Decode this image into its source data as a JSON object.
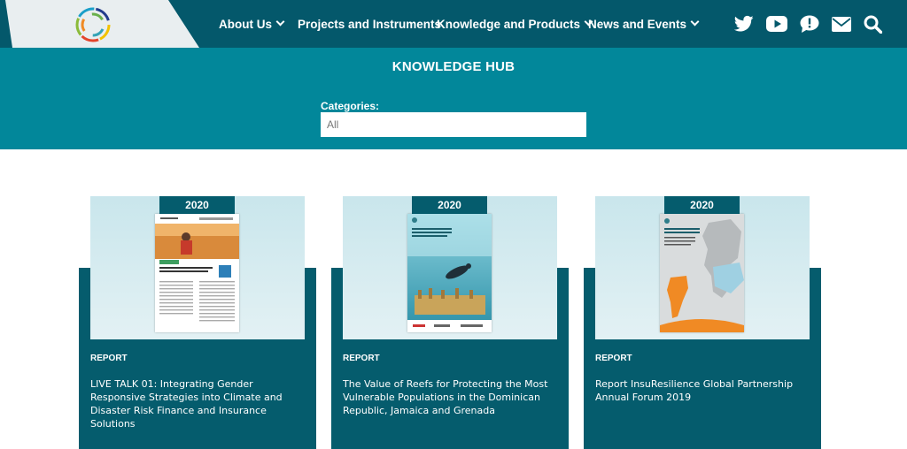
{
  "header": {
    "logo_icon": "circular-swirl-logo",
    "nav": [
      {
        "label": "About Us",
        "has_dropdown": true
      },
      {
        "label": "Projects and Instruments",
        "has_dropdown": false
      },
      {
        "label": "Knowledge and Products",
        "has_dropdown": true
      },
      {
        "label": "News and Events",
        "has_dropdown": true
      }
    ],
    "icons": [
      "twitter-icon",
      "youtube-icon",
      "feedback-bubble-icon",
      "envelope-icon",
      "search-icon"
    ]
  },
  "hero": {
    "title": "KNOWLEDGE HUB",
    "categories_label": "Categories:",
    "categories_value": "All"
  },
  "cards": [
    {
      "year": "2020",
      "type": "REPORT",
      "title": "LIVE TALK 01: Integrating Gender Responsive Strategies into Climate and Disaster Risk Finance and Insurance Solutions"
    },
    {
      "year": "2020",
      "type": "REPORT",
      "title": "The Value of Reefs for Protecting the Most Vulnerable Populations in the Dominican Republic, Jamaica and Grenada"
    },
    {
      "year": "2020",
      "type": "REPORT",
      "title": "Report InsuResilience Global Partnership Annual Forum 2019"
    }
  ],
  "colors": {
    "nav_bg": "#04586b",
    "hero_bg": "#02879a",
    "card_bg": "#055c6d",
    "thumb_bg": "#d4ebf0"
  }
}
